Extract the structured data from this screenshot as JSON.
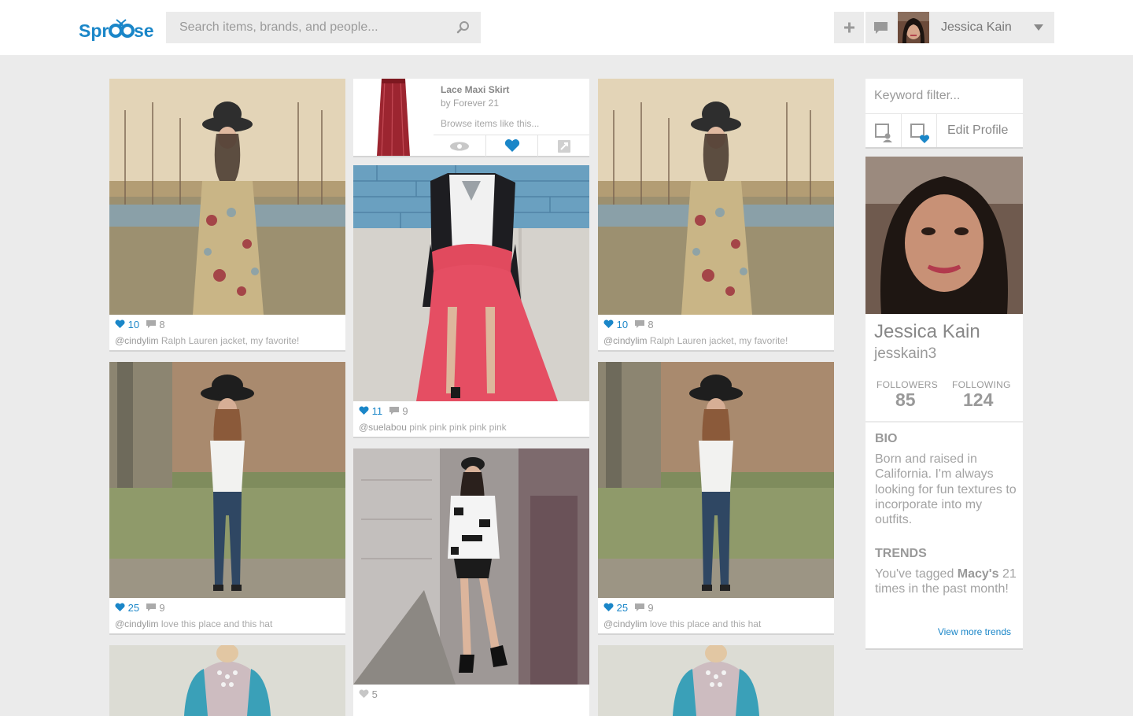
{
  "app": {
    "logo_text": "Spr",
    "logo_text2": "se"
  },
  "search": {
    "placeholder": "Search items, brands, and people..."
  },
  "user": {
    "name": "Jessica Kain"
  },
  "feed": {
    "col1": [
      {
        "likes": "10",
        "comments": "8",
        "user": "@cindylim",
        "caption": "Ralph Lauren jacket, my favorite!"
      },
      {
        "likes": "25",
        "comments": "9",
        "user": "@cindylim",
        "caption": "love this place and this hat"
      }
    ],
    "product": {
      "title": "Lace Maxi Skirt",
      "by": "by Forever 21",
      "browse": "Browse items like this..."
    },
    "col2": [
      {
        "likes": "11",
        "comments": "9",
        "user": "@suelabou",
        "caption": "pink pink pink pink pink"
      },
      {
        "likes": "5"
      }
    ],
    "col3": [
      {
        "likes": "10",
        "comments": "8",
        "user": "@cindylim",
        "caption": "Ralph Lauren jacket, my favorite!"
      },
      {
        "likes": "25",
        "comments": "9",
        "user": "@cindylim",
        "caption": "love this place and this hat"
      }
    ]
  },
  "sidebar": {
    "keyword_placeholder": "Keyword filter...",
    "edit_profile": "Edit Profile",
    "profile": {
      "name": "Jessica Kain",
      "handle": "jesskain3",
      "followers_label": "FOLLOWERS",
      "followers": "85",
      "following_label": "FOLLOWING",
      "following": "124"
    },
    "bio": {
      "heading": "BIO",
      "text": "Born and raised in California. I'm always looking for fun textures to incorporate into my outfits."
    },
    "trends": {
      "heading": "TRENDS",
      "text_pre": "You've tagged ",
      "brand": "Macy's",
      "text_post": " 21 times in the past month!",
      "link": "View more trends"
    }
  },
  "colors": {
    "accent": "#1a86c8",
    "background": "#ebebeb"
  }
}
